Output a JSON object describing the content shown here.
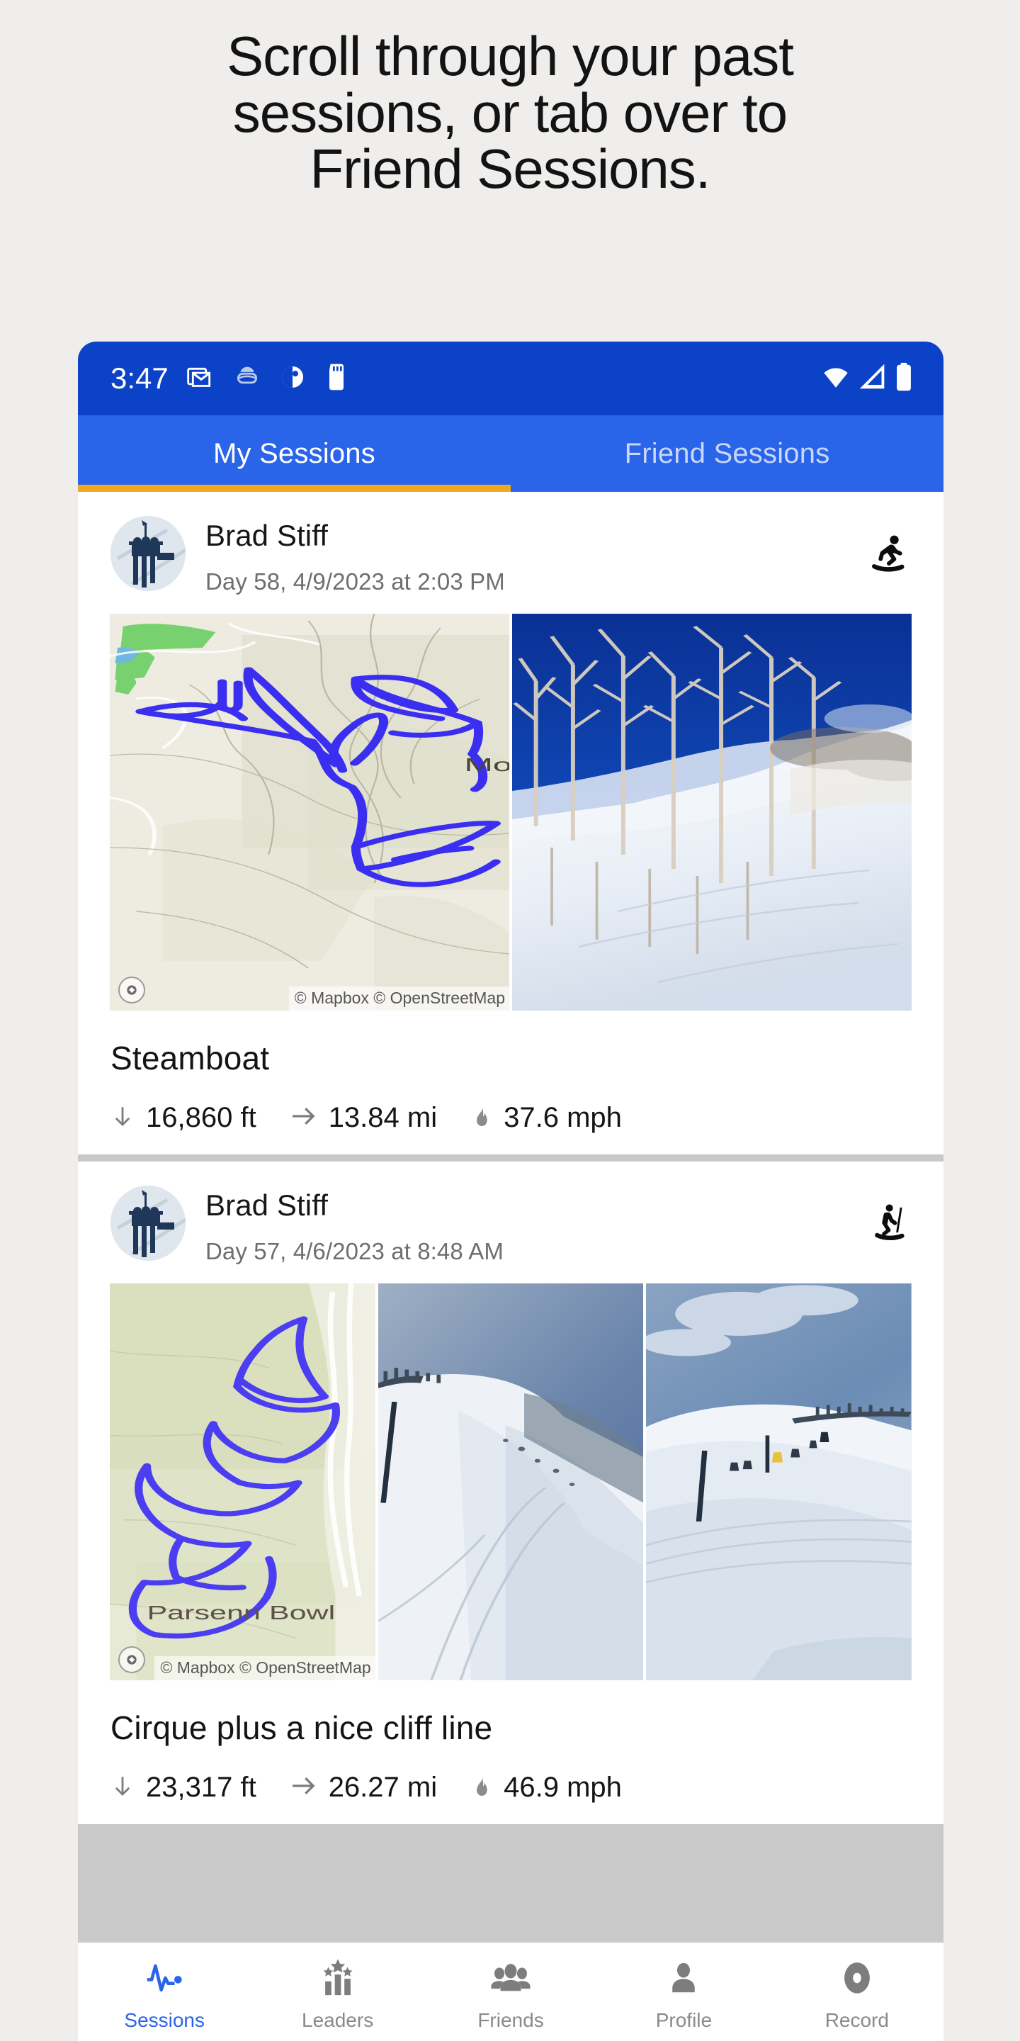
{
  "headline": {
    "lines": [
      "Scroll through your past",
      "sessions, or tab over to",
      "Friend Sessions."
    ]
  },
  "status_bar": {
    "time": "3:47",
    "icons": [
      "gmail-icon",
      "goggles-icon",
      "contrast-icon",
      "sd-card-icon"
    ],
    "right_icons": [
      "wifi-icon",
      "signal-icon",
      "battery-icon"
    ]
  },
  "tabs": {
    "items": [
      {
        "label": "My Sessions",
        "active": true
      },
      {
        "label": "Friend Sessions",
        "active": false
      }
    ],
    "active_color": "#f0a81e",
    "bar_color": "#2a64e8"
  },
  "sessions": [
    {
      "user": "Brad Stiff",
      "date": "Day 58, 4/9/2023 at 2:03 PM",
      "sport_icon": "snowboarder-icon",
      "title": "Steamboat",
      "map_attribution": "© Mapbox © OpenStreetMap",
      "map_label": "Mou",
      "stats": [
        {
          "icon": "arrow-down-icon",
          "value": "16,860 ft"
        },
        {
          "icon": "arrow-right-icon",
          "value": "13.84 mi"
        },
        {
          "icon": "flame-icon",
          "value": "37.6 mph"
        }
      ]
    },
    {
      "user": "Brad Stiff",
      "date": "Day 57, 4/6/2023 at 8:48 AM",
      "sport_icon": "skier-icon",
      "title": "Cirque plus a nice cliff line",
      "map_attribution": "© Mapbox © OpenStreetMap",
      "map_label": "Parsenn Bowl",
      "stats": [
        {
          "icon": "arrow-down-icon",
          "value": "23,317 ft"
        },
        {
          "icon": "arrow-right-icon",
          "value": "26.27 mi"
        },
        {
          "icon": "flame-icon",
          "value": "46.9 mph"
        }
      ]
    }
  ],
  "bottom_nav": {
    "items": [
      {
        "label": "Sessions",
        "icon": "pulse-icon",
        "active": true
      },
      {
        "label": "Leaders",
        "icon": "podium-star-icon",
        "active": false
      },
      {
        "label": "Friends",
        "icon": "people-icon",
        "active": false
      },
      {
        "label": "Profile",
        "icon": "person-icon",
        "active": false
      },
      {
        "label": "Record",
        "icon": "record-circle-icon",
        "active": false
      }
    ],
    "active_color": "#2a64e8",
    "inactive_color": "#7d7d7d"
  },
  "colors": {
    "background": "#efeeec",
    "status_bar": "#0b42c8",
    "track": "#3a2ef0"
  }
}
